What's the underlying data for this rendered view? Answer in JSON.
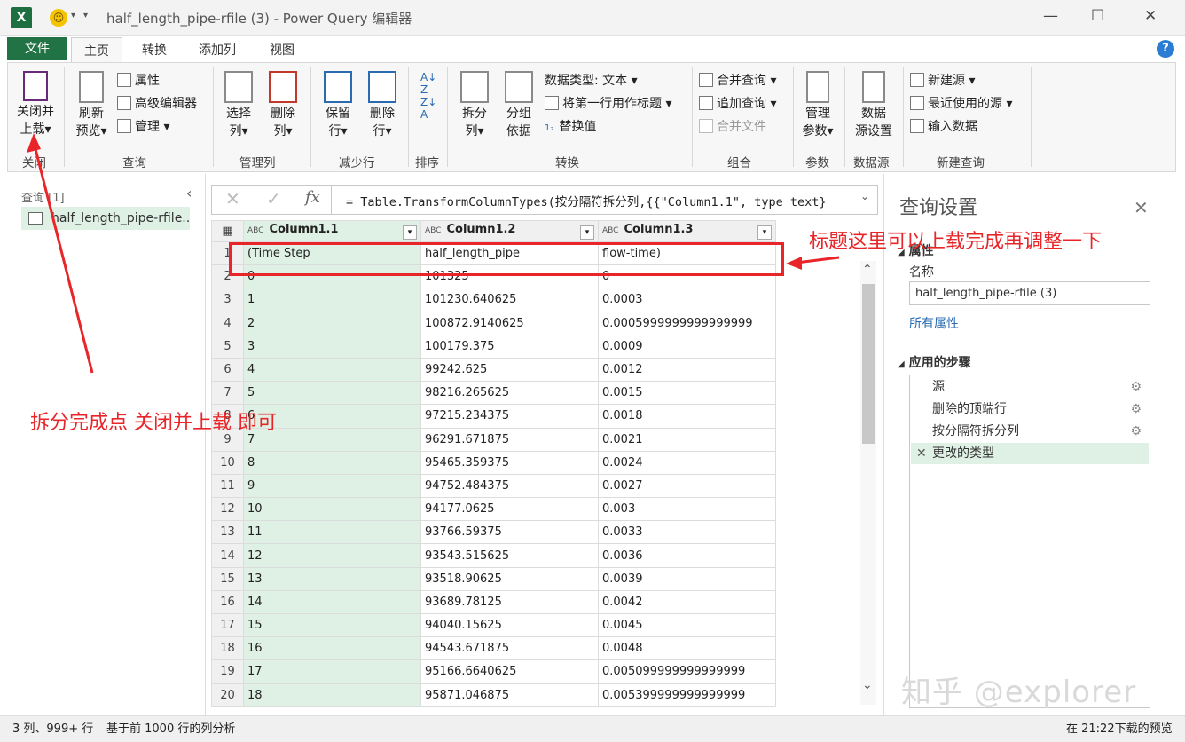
{
  "titlebar": {
    "title": "half_length_pipe-rfile (3) - Power Query 编辑器",
    "logo": "X",
    "minimize": "—",
    "maximize": "☐",
    "close": "✕"
  },
  "tabs": [
    "文件",
    "主页",
    "转换",
    "添加列",
    "视图"
  ],
  "ribbon": {
    "close": {
      "label1": "关闭并",
      "label2": "上载",
      "group": "关闭"
    },
    "query": {
      "refresh1": "刷新",
      "refresh2": "预览",
      "properties": "属性",
      "advanced": "高级编辑器",
      "manage": "管理",
      "group": "查询"
    },
    "manage_cols": {
      "choose1": "选择",
      "choose2": "列",
      "remove1": "删除",
      "remove2": "列",
      "group": "管理列"
    },
    "reduce_rows": {
      "keep1": "保留",
      "keep2": "行",
      "remove1": "删除",
      "remove2": "行",
      "group": "减少行"
    },
    "sort": {
      "group": "排序"
    },
    "transform": {
      "split1": "拆分",
      "split2": "列",
      "groupby1": "分组",
      "groupby2": "依据",
      "datatype": "数据类型: 文本",
      "firstrow": "将第一行用作标题",
      "replace": "替换值",
      "group": "转换"
    },
    "combine": {
      "merge": "合并查询",
      "append": "追加查询",
      "combine_files": "合并文件",
      "group": "组合"
    },
    "params": {
      "manage1": "管理",
      "manage2": "参数",
      "group": "参数"
    },
    "datasource": {
      "settings1": "数据",
      "settings2": "源设置",
      "group": "数据源"
    },
    "newquery": {
      "new_source": "新建源",
      "recent": "最近使用的源",
      "enter": "输入数据",
      "group": "新建查询"
    }
  },
  "queries_pane": {
    "header": "查询 [1]",
    "item": "half_length_pipe-rfile..."
  },
  "formula": {
    "text": "= Table.TransformColumnTypes(按分隔符拆分列,{{\"Column1.1\", type text}"
  },
  "grid": {
    "columns": [
      "Column1.1",
      "Column1.2",
      "Column1.3"
    ],
    "type_prefix": "ABC",
    "rows": [
      [
        "1",
        "(Time Step",
        "half_length_pipe",
        "flow-time)"
      ],
      [
        "2",
        "0",
        "101325",
        "0"
      ],
      [
        "3",
        "1",
        "101230.640625",
        "0.0003"
      ],
      [
        "4",
        "2",
        "100872.9140625",
        "0.0005999999999999999"
      ],
      [
        "5",
        "3",
        "100179.375",
        "0.0009"
      ],
      [
        "6",
        "4",
        "99242.625",
        "0.0012"
      ],
      [
        "7",
        "5",
        "98216.265625",
        "0.0015"
      ],
      [
        "8",
        "6",
        "97215.234375",
        "0.0018"
      ],
      [
        "9",
        "7",
        "96291.671875",
        "0.0021"
      ],
      [
        "10",
        "8",
        "95465.359375",
        "0.0024"
      ],
      [
        "11",
        "9",
        "94752.484375",
        "0.0027"
      ],
      [
        "12",
        "10",
        "94177.0625",
        "0.003"
      ],
      [
        "13",
        "11",
        "93766.59375",
        "0.0033"
      ],
      [
        "14",
        "12",
        "93543.515625",
        "0.0036"
      ],
      [
        "15",
        "13",
        "93518.90625",
        "0.0039"
      ],
      [
        "16",
        "14",
        "93689.78125",
        "0.0042"
      ],
      [
        "17",
        "15",
        "94040.15625",
        "0.0045"
      ],
      [
        "18",
        "16",
        "94543.671875",
        "0.0048"
      ],
      [
        "19",
        "17",
        "95166.6640625",
        "0.005099999999999999"
      ],
      [
        "20",
        "18",
        "95871.046875",
        "0.005399999999999999"
      ]
    ]
  },
  "settings": {
    "title": "查询设置",
    "properties": "属性",
    "name_label": "名称",
    "name_value": "half_length_pipe-rfile (3)",
    "all_props": "所有属性",
    "applied_steps": "应用的步骤",
    "steps": [
      "源",
      "删除的顶端行",
      "按分隔符拆分列",
      "更改的类型"
    ]
  },
  "status": {
    "left": "3 列、999+ 行",
    "middle": "基于前 1000 行的列分析",
    "right": "在 21:22下载的预览"
  },
  "annotations": {
    "header_note": "标题这里可以上载完成再调整一下",
    "close_note": "拆分完成点 关闭并上载 即可"
  },
  "watermark": "知乎 @explorer",
  "colors": {
    "excel_green": "#217346",
    "selection_green": "#dff0e5",
    "annotation_red": "#e8262a"
  }
}
